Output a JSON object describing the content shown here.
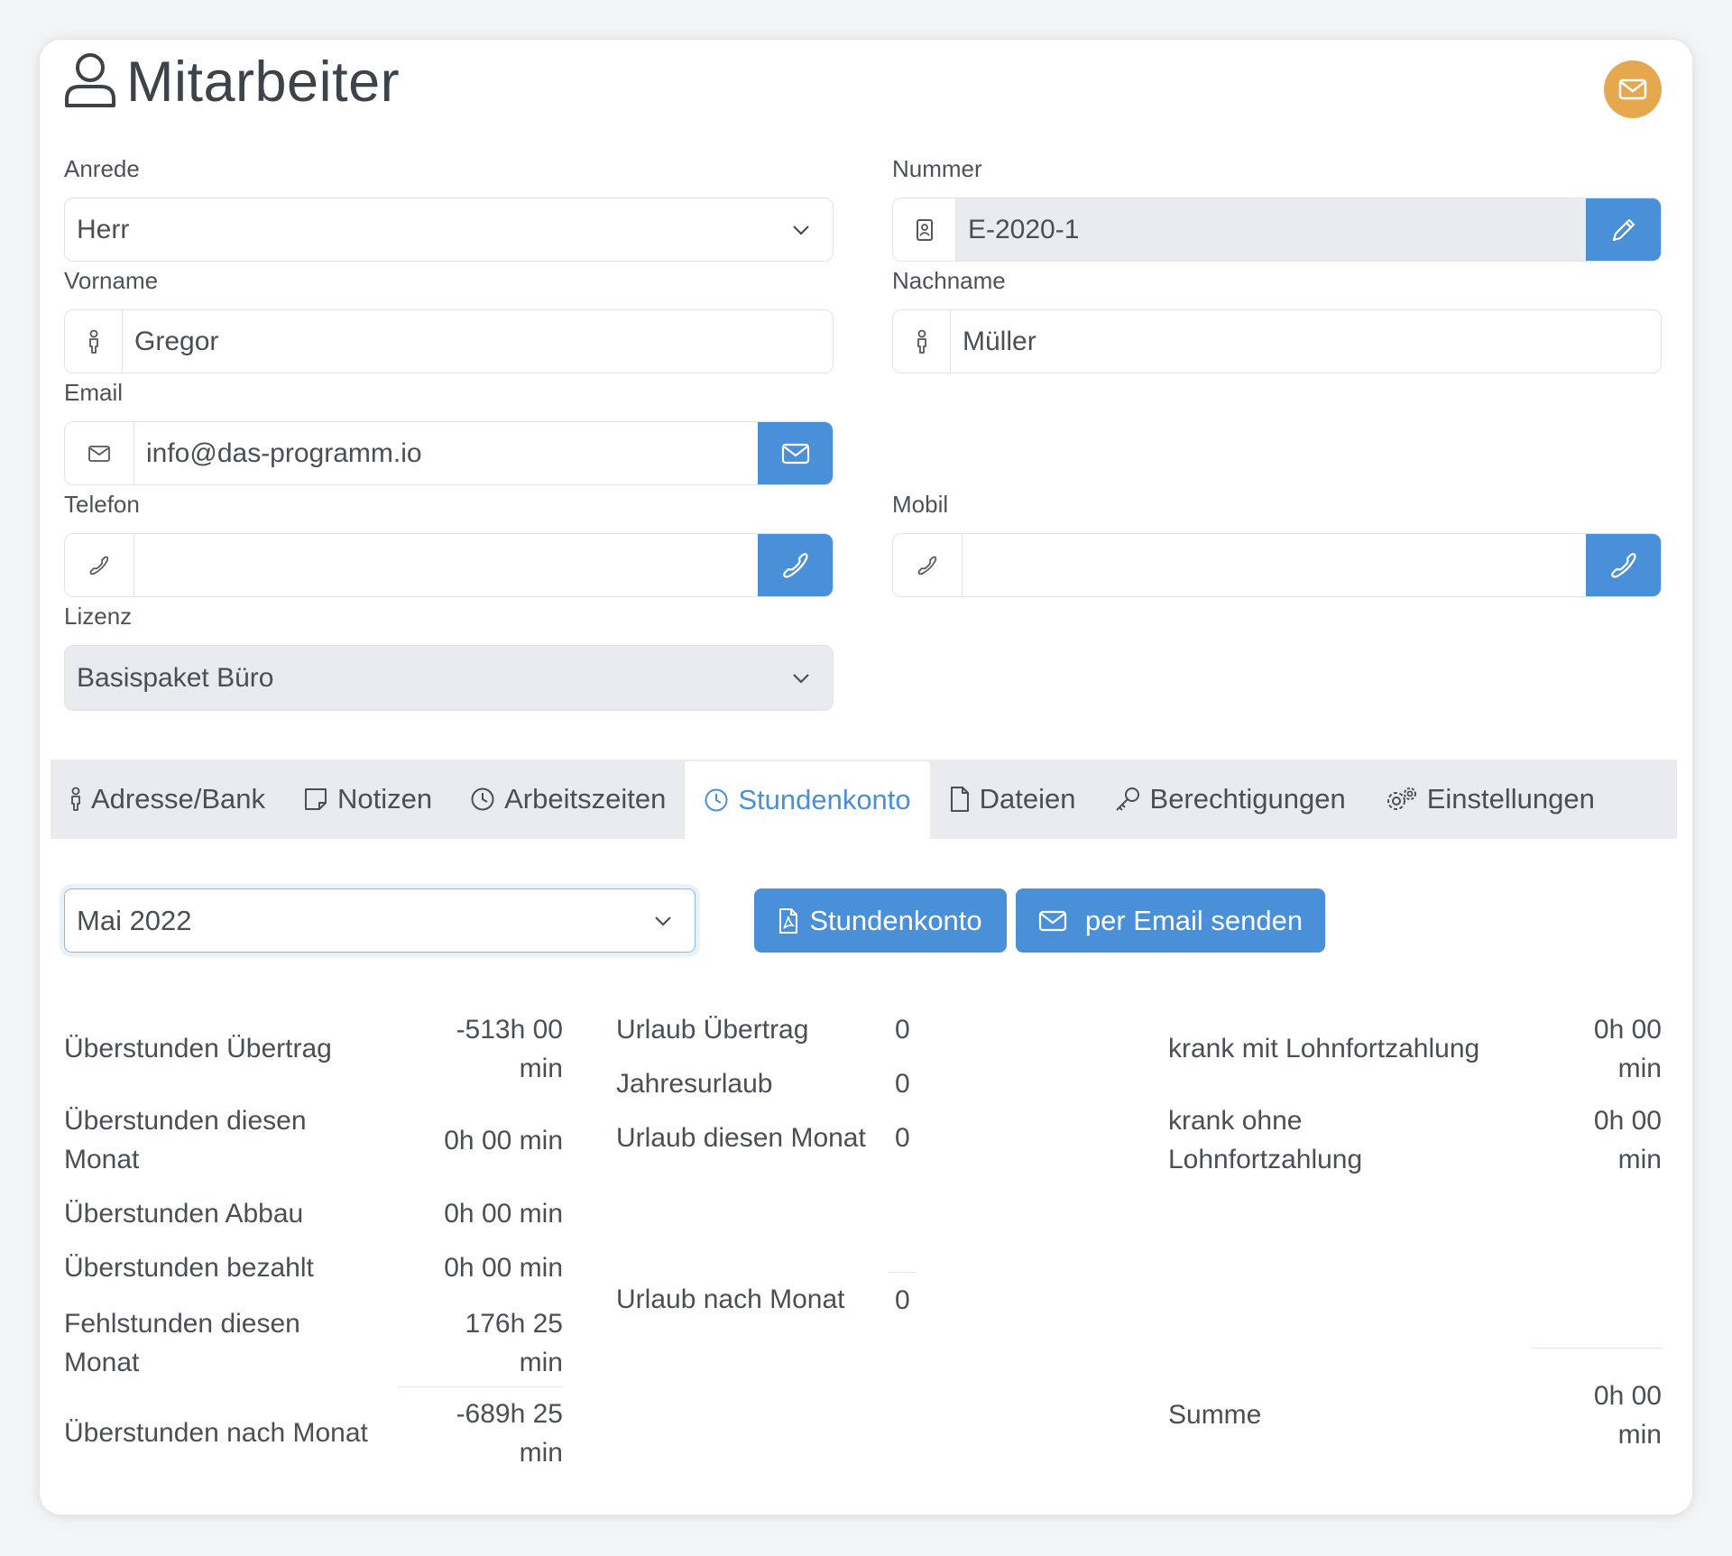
{
  "header": {
    "title": "Mitarbeiter"
  },
  "colors": {
    "primary": "#4a90d9",
    "accent": "#e6a84f"
  },
  "form": {
    "anrede": {
      "label": "Anrede",
      "value": "Herr"
    },
    "nummer": {
      "label": "Nummer",
      "value": "E-2020-1"
    },
    "vorname": {
      "label": "Vorname",
      "value": "Gregor"
    },
    "nachname": {
      "label": "Nachname",
      "value": "Müller"
    },
    "email": {
      "label": "Email",
      "value": "info@das-programm.io"
    },
    "telefon": {
      "label": "Telefon",
      "value": ""
    },
    "mobil": {
      "label": "Mobil",
      "value": ""
    },
    "lizenz": {
      "label": "Lizenz",
      "value": "Basispaket Büro"
    }
  },
  "tabs": [
    {
      "label": "Adresse/Bank",
      "icon": "person-icon"
    },
    {
      "label": "Notizen",
      "icon": "note-icon"
    },
    {
      "label": "Arbeitszeiten",
      "icon": "clock-icon"
    },
    {
      "label": "Stundenkonto",
      "icon": "clock-icon",
      "active": true
    },
    {
      "label": "Dateien",
      "icon": "file-icon"
    },
    {
      "label": "Berechtigungen",
      "icon": "key-icon"
    },
    {
      "label": "Einstellungen",
      "icon": "gears-icon"
    }
  ],
  "stundenkonto": {
    "month": "Mai 2022",
    "pdf_button": "Stundenkonto",
    "email_button": "per Email senden",
    "overtime": [
      {
        "label": "Überstunden Übertrag",
        "value": "-513h 00 min"
      },
      {
        "label": "Überstunden diesen Monat",
        "value": "0h 00 min"
      },
      {
        "label": "Überstunden Abbau",
        "value": "0h 00 min"
      },
      {
        "label": "Überstunden bezahlt",
        "value": "0h 00 min"
      },
      {
        "label": "Fehlstunden diesen Monat",
        "value": "176h 25 min"
      },
      {
        "label": "Überstunden nach Monat",
        "value": "-689h 25 min"
      }
    ],
    "vacation": [
      {
        "label": "Urlaub Übertrag",
        "value": "0"
      },
      {
        "label": "Jahresurlaub",
        "value": "0"
      },
      {
        "label": "Urlaub diesen Monat",
        "value": "0"
      },
      {
        "label": "Urlaub nach Monat",
        "value": "0"
      }
    ],
    "sick": [
      {
        "label": "krank mit Lohnfortzahlung",
        "value": "0h 00 min"
      },
      {
        "label": "krank ohne Lohnfortzahlung",
        "value": "0h 00 min"
      },
      {
        "label": "Summe",
        "value": "0h 00 min"
      }
    ]
  }
}
